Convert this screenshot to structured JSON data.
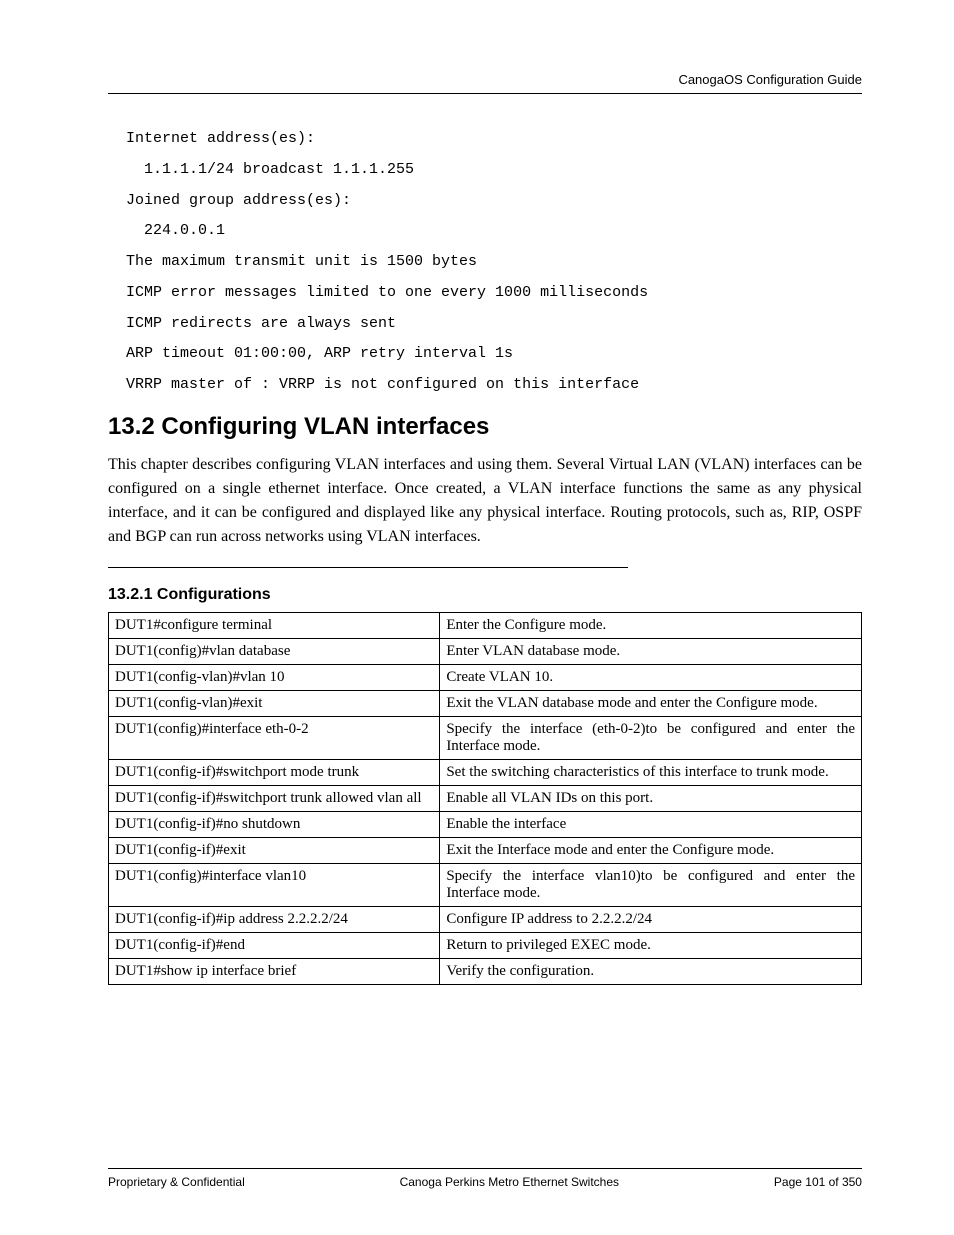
{
  "header": {
    "right": "CanogaOS Configuration Guide"
  },
  "code": "Internet address(es):\n  1.1.1.1/24 broadcast 1.1.1.255\nJoined group address(es):\n  224.0.0.1\nThe maximum transmit unit is 1500 bytes\nICMP error messages limited to one every 1000 milliseconds\nICMP redirects are always sent\nARP timeout 01:00:00, ARP retry interval 1s\nVRRP master of : VRRP is not configured on this interface",
  "section": {
    "number": "13.2",
    "title": "Configuring VLAN interfaces",
    "full": "13.2  Configuring VLAN interfaces"
  },
  "intro": "This chapter describes configuring VLAN interfaces and using them. Several Virtual LAN (VLAN) interfaces can be configured on a single ethernet interface. Once created, a VLAN interface functions the same as any physical interface, and it can be configured and displayed like any physical interface. Routing protocols, such as, RIP, OSPF and BGP can run across networks using VLAN interfaces.",
  "subsection": {
    "full": "13.2.1 Configurations"
  },
  "table": {
    "rows": [
      {
        "cmd": "DUT1#configure terminal",
        "desc": "Enter the Configure mode.",
        "justify": false
      },
      {
        "cmd": "DUT1(config)#vlan database",
        "desc": "Enter VLAN database mode.",
        "justify": false
      },
      {
        "cmd": "DUT1(config-vlan)#vlan 10",
        "desc": "Create VLAN 10.",
        "justify": false
      },
      {
        "cmd": "DUT1(config-vlan)#exit",
        "desc": "Exit the VLAN database mode and enter the Configure mode.",
        "justify": true
      },
      {
        "cmd": "DUT1(config)#interface eth-0-2",
        "desc": "Specify the interface (eth-0-2)to be configured and enter the Interface mode.",
        "justify": true
      },
      {
        "cmd": "DUT1(config-if)#switchport mode trunk",
        "desc": "Set the switching characteristics of this interface to trunk mode.",
        "justify": true
      },
      {
        "cmd": "DUT1(config-if)#switchport trunk allowed vlan all",
        "desc": "Enable all VLAN IDs on this port.",
        "justify": false
      },
      {
        "cmd": "DUT1(config-if)#no shutdown",
        "desc": "Enable the interface",
        "justify": false
      },
      {
        "cmd": "DUT1(config-if)#exit",
        "desc": "Exit the Interface mode and enter the Configure mode.",
        "justify": false
      },
      {
        "cmd": "DUT1(config)#interface vlan10",
        "desc": "Specify the interface vlan10)to be  configured and enter the Interface mode.",
        "justify": true
      },
      {
        "cmd": "DUT1(config-if)#ip address 2.2.2.2/24",
        "desc": "Configure IP address to 2.2.2.2/24",
        "justify": false
      },
      {
        "cmd": "DUT1(config-if)#end",
        "desc": "Return to privileged EXEC mode.",
        "justify": false
      },
      {
        "cmd": "DUT1#show ip interface brief",
        "desc": "Verify the configuration.",
        "justify": false
      }
    ]
  },
  "footer": {
    "left": "Proprietary & Confidential",
    "center": "Canoga Perkins Metro Ethernet Switches",
    "right": "Page 101 of 350"
  }
}
